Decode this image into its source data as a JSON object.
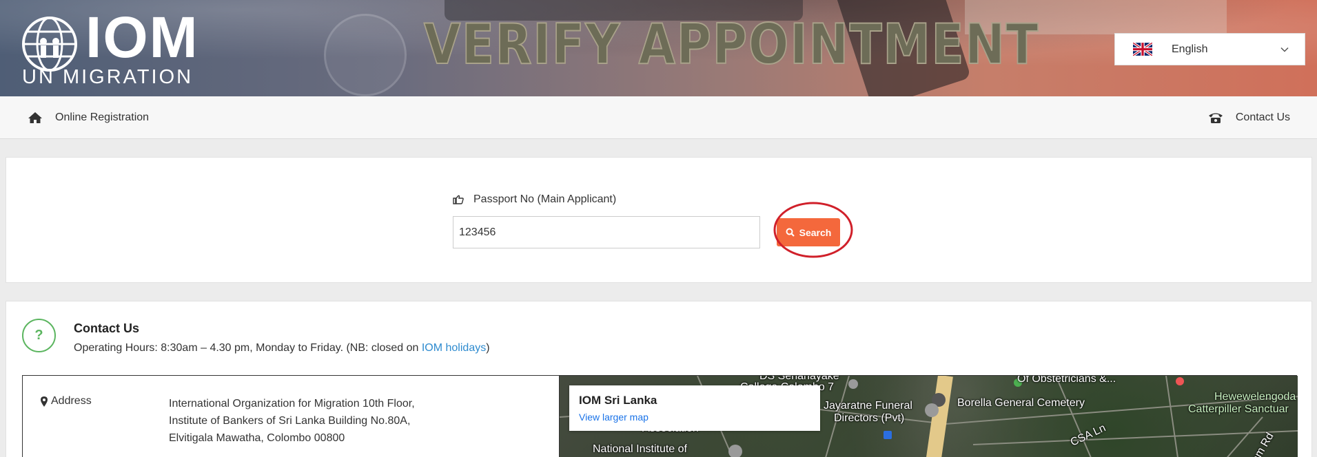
{
  "header": {
    "logo_main": "IOM",
    "logo_sub": "UN MIGRATION",
    "banner_title": "VERIFY APPOINTMENT",
    "language": {
      "selected": "English",
      "flag_icon": "uk-flag-icon"
    }
  },
  "nav": {
    "home_label": "Online Registration",
    "contact_label": "Contact Us"
  },
  "search": {
    "field_label": "Passport No (Main Applicant)",
    "field_value": "123456",
    "button_label": "Search",
    "button_color": "#f4683c",
    "highlight_color": "#d0202a"
  },
  "contact": {
    "title": "Contact Us",
    "hours_prefix": "Operating Hours: 8:30am – 4.30 pm, Monday to Friday. (NB: closed on ",
    "hours_link": "IOM holidays",
    "hours_suffix": ")",
    "address_label": "Address",
    "address_lines": [
      "International Organization for Migration 10th Floor,",
      "Institute of Bankers of Sri Lanka Building No.80A,",
      "Elvitigala Mawatha, Colombo 00800"
    ]
  },
  "map": {
    "card_title": "IOM Sri Lanka",
    "card_link": "View larger map",
    "labels": {
      "l1": "DS Senanayake",
      "l2": "College Colombo 7",
      "l3": "Jayaratne Funeral",
      "l4": "Directors (Pvt)",
      "l5": "Borella General Cemetery",
      "l6": "Of Obstetricians &...",
      "l7": "Hewewelengoda",
      "l8": "Catterpiller Sanctuar",
      "l9": "CSA Ln",
      "l10": "National Institute of",
      "l11": "Association",
      "l12": "Fam Rd"
    }
  }
}
